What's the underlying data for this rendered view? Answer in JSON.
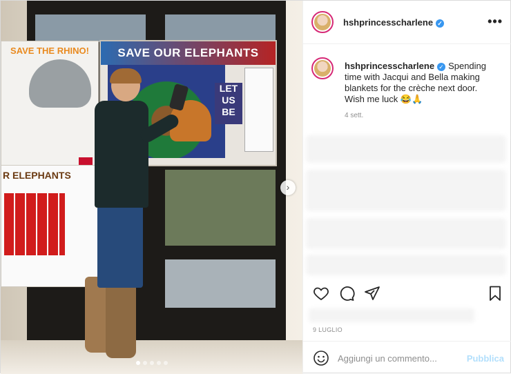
{
  "post": {
    "username": "hshprincesscharlene",
    "verified": true,
    "caption_text": "Spending time with Jacqui and Bella making blankets for the crèche next door. Wish me luck 😂🙏",
    "caption_time": "4 sett.",
    "date": "9 LUGLIO"
  },
  "media": {
    "poster_main_title": "SAVE OUR ELEPHANTS",
    "poster_left_title": "SAVE THE RHINO!",
    "poster_low_title": "R ELEPHANTS",
    "poster_letus": "LET US BE",
    "carousel_count": 5,
    "carousel_active_index": 0,
    "next_icon": "chevron-right-icon"
  },
  "header": {
    "more_label": "•••"
  },
  "comment": {
    "placeholder": "Aggiungi un commento...",
    "publish_label": "Pubblica"
  },
  "icons": {
    "like": "heart-icon",
    "comment": "comment-icon",
    "share": "send-icon",
    "save": "bookmark-icon",
    "emoji": "emoji-icon"
  },
  "colors": {
    "verified": "#3897f0",
    "avatar_ring": "#d62976",
    "publish_disabled": "#b2dffc"
  }
}
